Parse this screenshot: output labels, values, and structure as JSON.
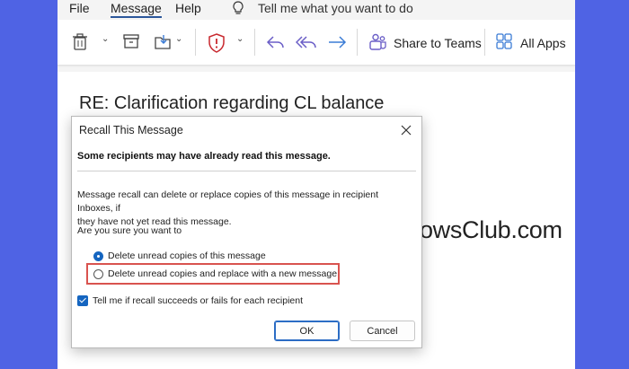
{
  "menu": {
    "file": "File",
    "message": "Message",
    "help": "Help",
    "tell_me_placeholder": "Tell me what you want to do",
    "tell_me_icon": "lightbulb-icon"
  },
  "ribbon": {
    "share_to_teams": "Share to Teams",
    "all_apps": "All Apps",
    "icons": [
      "delete-icon",
      "archive-icon",
      "move-icon",
      "report-icon",
      "reply-icon",
      "reply-all-icon",
      "forward-icon",
      "teams-icon",
      "apps-grid-icon"
    ]
  },
  "message": {
    "subject": "RE: Clarification regarding CL balance"
  },
  "dialog": {
    "title": "Recall This Message",
    "warning": "Some recipients may have already read this message.",
    "description_line1": "Message recall can delete or replace copies of this message in recipient Inboxes, if",
    "description_line2": "they have not yet read this message.",
    "question": "Are you sure you want to",
    "option_delete": "Delete unread copies of this message",
    "option_replace": "Delete unread copies and replace with a new message",
    "selected_option": "Delete unread copies of this message",
    "checkbox_label": "Tell me if recall succeeds or fails for each recipient",
    "checkbox_checked": true,
    "ok": "OK",
    "cancel": "Cancel"
  },
  "watermark": {
    "text": "TheWindowsClub.com"
  },
  "colors": {
    "background": "#4f63e4",
    "accent": "#1565c0",
    "highlight_border": "#d9534f",
    "ribbon_icon_purple": "#6b5fc7",
    "report_red": "#c8282e"
  }
}
